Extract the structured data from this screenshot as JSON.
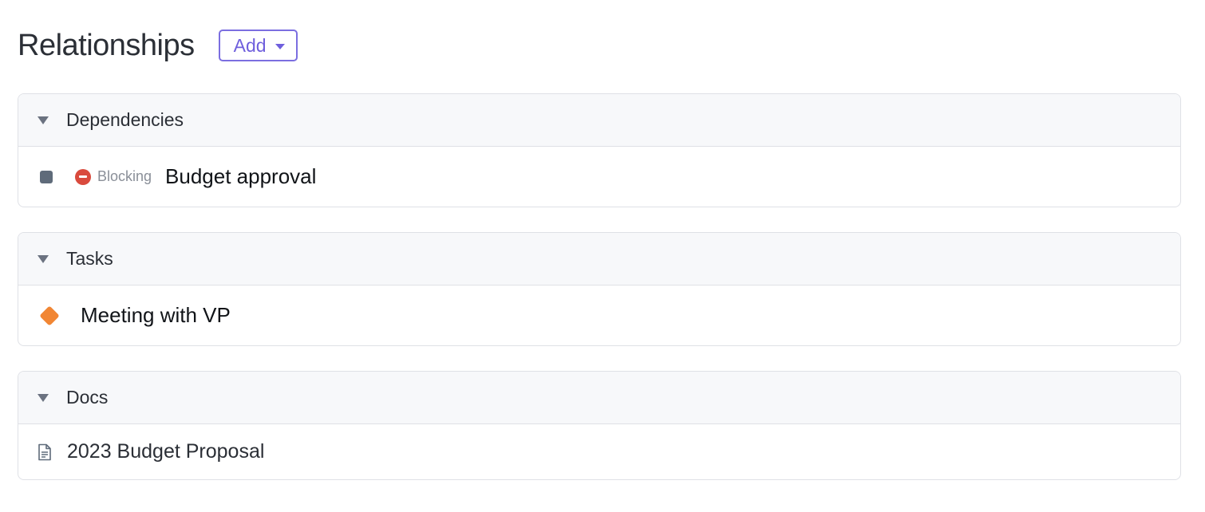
{
  "header": {
    "title": "Relationships",
    "add_label": "Add"
  },
  "sections": [
    {
      "title": "Dependencies",
      "items": [
        {
          "status_label": "Blocking",
          "text": "Budget approval",
          "icon": "square-status-icon",
          "status_icon": "blocking-icon"
        }
      ]
    },
    {
      "title": "Tasks",
      "items": [
        {
          "text": "Meeting with VP",
          "icon": "orange-diamond-icon"
        }
      ]
    },
    {
      "title": "Docs",
      "items": [
        {
          "text": "2023 Budget Proposal",
          "icon": "document-icon"
        }
      ]
    }
  ],
  "colors": {
    "accent": "#6f5fdd",
    "blocking": "#d94a3d",
    "task_diamond": "#f18634",
    "status_square": "#5f6b7a"
  }
}
